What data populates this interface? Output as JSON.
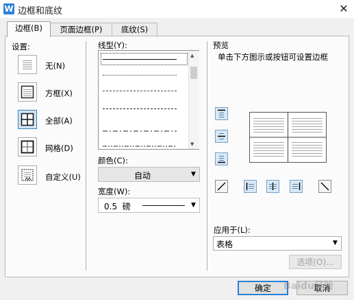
{
  "window": {
    "title": "边框和底纹",
    "app_icon_letter": "W",
    "close_glyph": "✕"
  },
  "tabs": [
    {
      "label": "边框(B)",
      "active": true
    },
    {
      "label": "页面边框(P)",
      "active": false
    },
    {
      "label": "底纹(S)",
      "active": false
    }
  ],
  "settings": {
    "label": "设置:",
    "items": [
      {
        "label": "无(N)",
        "selected": false
      },
      {
        "label": "方框(X)",
        "selected": false
      },
      {
        "label": "全部(A)",
        "selected": true
      },
      {
        "label": "网格(D)",
        "selected": false
      },
      {
        "label": "自定义(U)",
        "selected": false
      }
    ]
  },
  "line_style": {
    "label": "线型(Y):",
    "selected_index": 0
  },
  "color": {
    "label": "颜色(C):",
    "value": "自动"
  },
  "width": {
    "label": "宽度(W):",
    "value": "0.5  磅"
  },
  "preview": {
    "label": "预览",
    "hint": "单击下方图示或按钮可设置边框"
  },
  "apply_to": {
    "label": "应用于(L):",
    "value": "表格"
  },
  "buttons": {
    "options": "选项(O)...",
    "ok": "确定",
    "cancel": "取消"
  },
  "watermark": "Baidu经验",
  "colors": {
    "accent": "#2a7fd6",
    "selected_bg": "#cfe4f7"
  }
}
